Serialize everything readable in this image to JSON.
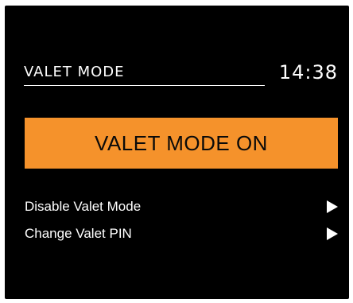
{
  "header": {
    "title": "VALET MODE",
    "clock": "14:38"
  },
  "status": {
    "label": "VALET MODE ON",
    "color": "#f5922b"
  },
  "menu": {
    "items": [
      {
        "label": "Disable Valet Mode",
        "icon": "play-arrow-icon"
      },
      {
        "label": "Change Valet PIN",
        "icon": "play-arrow-icon"
      }
    ]
  }
}
